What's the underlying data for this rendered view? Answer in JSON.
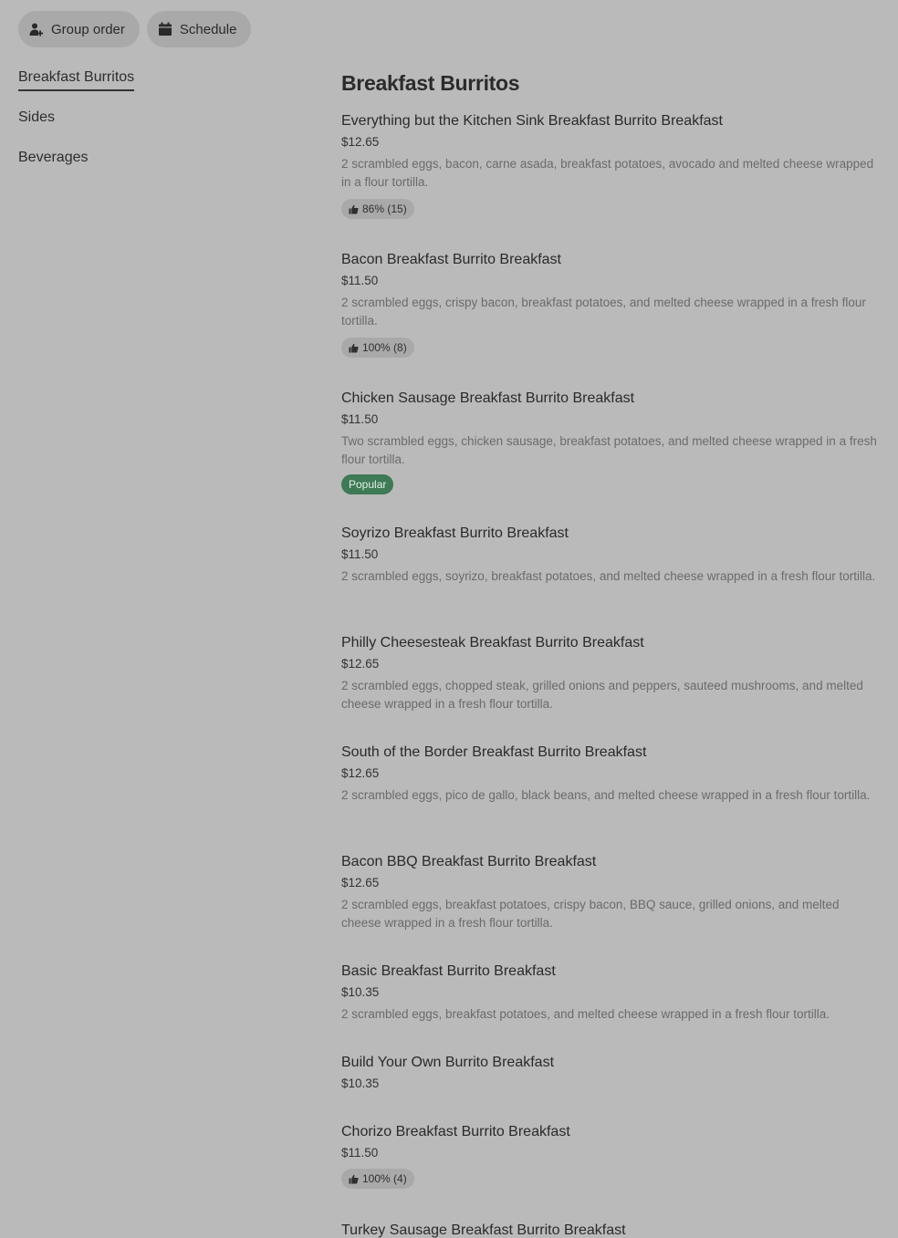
{
  "toolbar": {
    "group_order_label": "Group order",
    "group_order_icon": "add-person-icon",
    "schedule_label": "Schedule",
    "schedule_icon": "calendar-icon"
  },
  "sidebar": {
    "items": [
      {
        "label": "Breakfast Burritos",
        "active": true
      },
      {
        "label": "Sides",
        "active": false
      },
      {
        "label": "Beverages",
        "active": false
      }
    ]
  },
  "main": {
    "section_title": "Breakfast Burritos",
    "items": [
      {
        "name": "Everything but the Kitchen Sink Breakfast Burrito Breakfast",
        "price": "$12.65",
        "description": "2 scrambled eggs, bacon, carne asada, breakfast potatoes, avocado and melted cheese wrapped in a flour tortilla.",
        "rating": "86% (15)"
      },
      {
        "name": "Bacon Breakfast Burrito Breakfast",
        "price": "$11.50",
        "description": "2 scrambled eggs, crispy bacon, breakfast potatoes, and melted cheese wrapped in a fresh flour tortilla.",
        "rating": "100% (8)"
      },
      {
        "name": "Chicken Sausage Breakfast Burrito Breakfast",
        "price": "$11.50",
        "description": "Two scrambled eggs, chicken sausage, breakfast potatoes, and melted cheese wrapped in a fresh flour tortilla.",
        "tag": "Popular"
      },
      {
        "name": "Soyrizo Breakfast Burrito Breakfast",
        "price": "$11.50",
        "description": "2 scrambled eggs, soyrizo, breakfast potatoes, and melted cheese wrapped in a fresh flour tortilla."
      },
      {
        "name": "Philly Cheesesteak Breakfast Burrito Breakfast",
        "price": "$12.65",
        "description": "2 scrambled eggs, chopped steak, grilled onions and peppers, sauteed mushrooms, and melted cheese wrapped in a fresh flour tortilla."
      },
      {
        "name": "South of the Border Breakfast Burrito Breakfast",
        "price": "$12.65",
        "description": "2 scrambled eggs, pico de gallo, black beans, and melted cheese wrapped in a fresh flour tortilla."
      },
      {
        "name": "Bacon BBQ Breakfast Burrito Breakfast",
        "price": "$12.65",
        "description": "2 scrambled eggs, breakfast potatoes, crispy bacon, BBQ sauce, grilled onions, and melted cheese wrapped in a fresh flour tortilla."
      },
      {
        "name": "Basic Breakfast Burrito Breakfast",
        "price": "$10.35",
        "description": "2 scrambled eggs, breakfast potatoes, and melted cheese wrapped in a fresh flour tortilla."
      },
      {
        "name": "Build Your Own Burrito Breakfast",
        "price": "$10.35"
      },
      {
        "name": "Chorizo Breakfast Burrito Breakfast",
        "price": "$11.50",
        "rating": "100% (4)"
      },
      {
        "name": "Turkey Sausage Breakfast Burrito Breakfast"
      }
    ]
  },
  "colors": {
    "background": "#bababa",
    "pill": "#a9a9a9",
    "popular_badge": "#3d7a55"
  }
}
